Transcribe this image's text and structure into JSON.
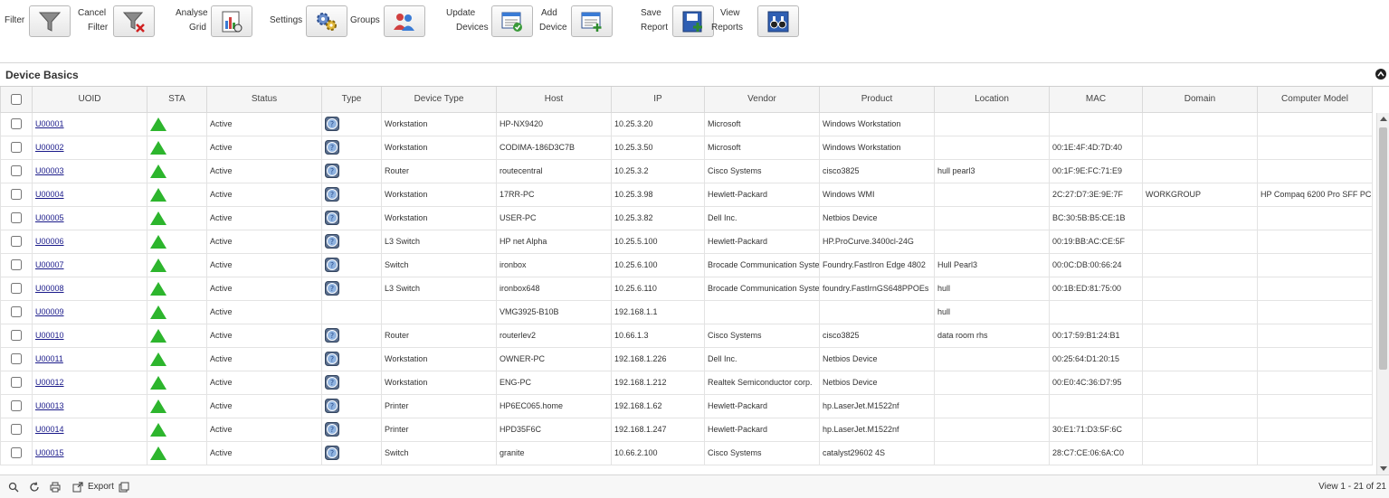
{
  "toolbar": {
    "filter": "Filter",
    "cancel_filter_1": "Cancel",
    "cancel_filter_2": "Filter",
    "analyse_grid_1": "Analyse",
    "analyse_grid_2": "Grid",
    "settings": "Settings",
    "groups": "Groups",
    "update_devices_1": "Update",
    "update_devices_2": "Devices",
    "add_device_1": "Add",
    "add_device_2": "Device",
    "save_report_1": "Save",
    "save_report_2": "Report",
    "view_reports_1": "View",
    "view_reports_2": "Reports"
  },
  "panel": {
    "title": "Device Basics"
  },
  "grid": {
    "columns": [
      "UOID",
      "STA",
      "Status",
      "Type",
      "Device Type",
      "Host",
      "IP",
      "Vendor",
      "Product",
      "Location",
      "MAC",
      "Domain",
      "Computer Model"
    ],
    "rows": [
      {
        "uoid": "U00001",
        "status": "Active",
        "has_type_icon": true,
        "device_type": "Workstation",
        "host": "HP-NX9420",
        "ip": "10.25.3.20",
        "vendor": "Microsoft",
        "product": "Windows Workstation",
        "location": "",
        "mac": "",
        "domain": "",
        "model": ""
      },
      {
        "uoid": "U00002",
        "status": "Active",
        "has_type_icon": true,
        "device_type": "Workstation",
        "host": "CODIMA-186D3C7B",
        "ip": "10.25.3.50",
        "vendor": "Microsoft",
        "product": "Windows Workstation",
        "location": "",
        "mac": "00:1E:4F:4D:7D:40",
        "domain": "",
        "model": ""
      },
      {
        "uoid": "U00003",
        "status": "Active",
        "has_type_icon": true,
        "device_type": "Router",
        "host": "routecentral",
        "ip": "10.25.3.2",
        "vendor": "Cisco Systems",
        "product": "cisco3825",
        "location": "hull pearl3",
        "mac": "00:1F:9E:FC:71:E9",
        "domain": "",
        "model": ""
      },
      {
        "uoid": "U00004",
        "status": "Active",
        "has_type_icon": true,
        "device_type": "Workstation",
        "host": "17RR-PC",
        "ip": "10.25.3.98",
        "vendor": "Hewlett-Packard",
        "product": "Windows WMI",
        "location": "",
        "mac": "2C:27:D7:3E:9E:7F",
        "domain": "WORKGROUP",
        "model": "HP Compaq 6200 Pro SFF PC"
      },
      {
        "uoid": "U00005",
        "status": "Active",
        "has_type_icon": true,
        "device_type": "Workstation",
        "host": "USER-PC",
        "ip": "10.25.3.82",
        "vendor": "Dell Inc.",
        "product": "Netbios Device",
        "location": "",
        "mac": "BC:30:5B:B5:CE:1B",
        "domain": "",
        "model": ""
      },
      {
        "uoid": "U00006",
        "status": "Active",
        "has_type_icon": true,
        "device_type": "L3 Switch",
        "host": "HP net Alpha",
        "ip": "10.25.5.100",
        "vendor": "Hewlett-Packard",
        "product": "HP.ProCurve.3400cl-24G",
        "location": "",
        "mac": "00:19:BB:AC:CE:5F",
        "domain": "",
        "model": ""
      },
      {
        "uoid": "U00007",
        "status": "Active",
        "has_type_icon": true,
        "device_type": "Switch",
        "host": "ironbox",
        "ip": "10.25.6.100",
        "vendor": "Brocade Communication Syste",
        "product": "Foundry.FastIron Edge 4802",
        "location": "Hull Pearl3",
        "mac": "00:0C:DB:00:66:24",
        "domain": "",
        "model": ""
      },
      {
        "uoid": "U00008",
        "status": "Active",
        "has_type_icon": true,
        "device_type": "L3 Switch",
        "host": "ironbox648",
        "ip": "10.25.6.110",
        "vendor": "Brocade Communication Syste",
        "product": "foundry.FastIrnGS648PPOEs",
        "location": "hull",
        "mac": "00:1B:ED:81:75:00",
        "domain": "",
        "model": ""
      },
      {
        "uoid": "U00009",
        "status": "Active",
        "has_type_icon": false,
        "device_type": "",
        "host": "VMG3925-B10B",
        "ip": "192.168.1.1",
        "vendor": "",
        "product": "",
        "location": "hull",
        "mac": "",
        "domain": "",
        "model": ""
      },
      {
        "uoid": "U00010",
        "status": "Active",
        "has_type_icon": true,
        "device_type": "Router",
        "host": "routerlev2",
        "ip": "10.66.1.3",
        "vendor": "Cisco Systems",
        "product": "cisco3825",
        "location": "data room rhs",
        "mac": "00:17:59:B1:24:B1",
        "domain": "",
        "model": ""
      },
      {
        "uoid": "U00011",
        "status": "Active",
        "has_type_icon": true,
        "device_type": "Workstation",
        "host": "OWNER-PC",
        "ip": "192.168.1.226",
        "vendor": "Dell Inc.",
        "product": "Netbios Device",
        "location": "",
        "mac": "00:25:64:D1:20:15",
        "domain": "",
        "model": ""
      },
      {
        "uoid": "U00012",
        "status": "Active",
        "has_type_icon": true,
        "device_type": "Workstation",
        "host": "ENG-PC",
        "ip": "192.168.1.212",
        "vendor": "Realtek Semiconductor corp.",
        "product": "Netbios Device",
        "location": "",
        "mac": "00:E0:4C:36:D7:95",
        "domain": "",
        "model": ""
      },
      {
        "uoid": "U00013",
        "status": "Active",
        "has_type_icon": true,
        "device_type": "Printer",
        "host": "HP6EC065.home",
        "ip": "192.168.1.62",
        "vendor": "Hewlett-Packard",
        "product": "hp.LaserJet.M1522nf",
        "location": "",
        "mac": "",
        "domain": "",
        "model": ""
      },
      {
        "uoid": "U00014",
        "status": "Active",
        "has_type_icon": true,
        "device_type": "Printer",
        "host": "HPD35F6C",
        "ip": "192.168.1.247",
        "vendor": "Hewlett-Packard",
        "product": "hp.LaserJet.M1522nf",
        "location": "",
        "mac": "30:E1:71:D3:5F:6C",
        "domain": "",
        "model": ""
      },
      {
        "uoid": "U00015",
        "status": "Active",
        "has_type_icon": true,
        "device_type": "Switch",
        "host": "granite",
        "ip": "10.66.2.100",
        "vendor": "Cisco Systems",
        "product": "catalyst29602 4S",
        "location": "",
        "mac": "28:C7:CE:06:6A:C0",
        "domain": "",
        "model": ""
      }
    ]
  },
  "footer": {
    "export_label": "Export",
    "view_info": "View 1 - 21 of 21"
  },
  "colors": {
    "status_green": "#2db52d",
    "link": "#1a1a8a"
  }
}
